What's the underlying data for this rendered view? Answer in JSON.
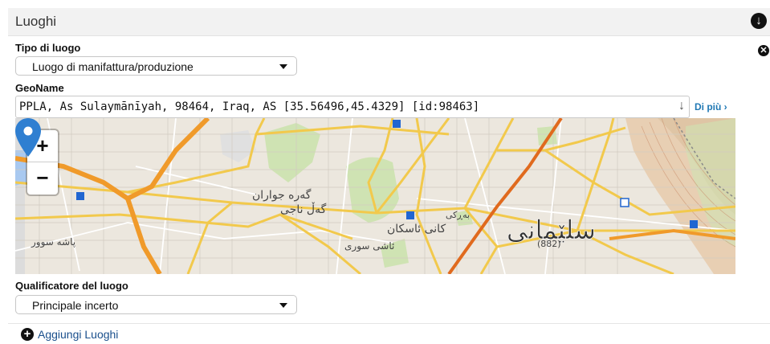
{
  "section": {
    "title": "Luoghi",
    "collapse_icon": "arrow-down-circle-icon",
    "remove_icon": "close-circle-icon"
  },
  "place_type": {
    "label": "Tipo di luogo",
    "value": "Luogo di manifattura/produzione"
  },
  "geoname": {
    "label": "GeoName",
    "value": "PPLA, As Sulaymānīyah, 98464, Iraq, AS [35.56496,45.4329] [id:98463]",
    "clear_icon": "down-arrow-icon",
    "more_link": "Di più ›"
  },
  "map": {
    "zoom_in": "+",
    "zoom_out": "−",
    "marker_icon": "map-marker-icon",
    "labels": [
      "سلێمانی",
      "کانی ئاسکان",
      "بەڕکی",
      "گەڵ ناجی",
      "گەرە جواران",
      "ئاشی سوری",
      "پاشە سوور"
    ],
    "number_badge": "(882)",
    "colors": {
      "major_road": "#f5d24b",
      "primary_road": "#f09a2a",
      "rail": "#e06a1e",
      "park": "#cfe3b3",
      "terrain": "#e8cfb3",
      "water": "#a9c9f0"
    }
  },
  "qualifier": {
    "label": "Qualificatore del luogo",
    "value": "Principale incerto"
  },
  "footer": {
    "add_label": "Aggiungi Luoghi",
    "add_icon": "plus-circle-icon"
  }
}
